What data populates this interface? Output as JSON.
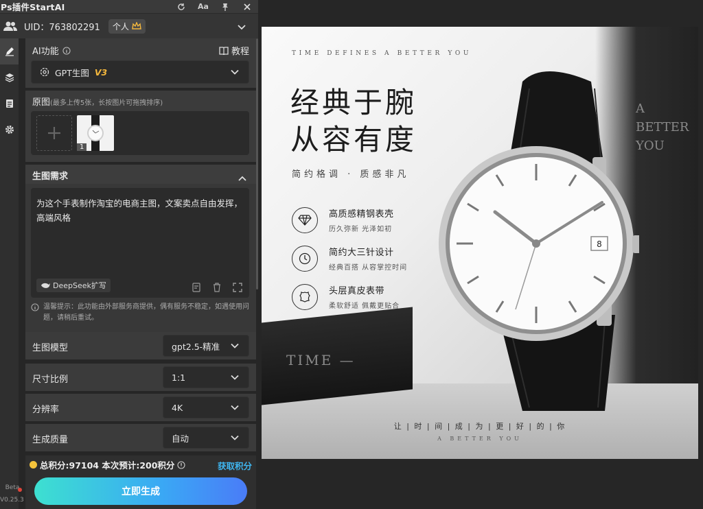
{
  "window": {
    "title": "Ps插件StartAI"
  },
  "titlebar_icons": [
    "refresh-icon",
    "font-size-icon",
    "pin-icon",
    "close-icon"
  ],
  "user": {
    "uid": "UID：763802291",
    "plan": "个人"
  },
  "sidebar": {
    "items": [
      "edit-icon",
      "layers-icon",
      "document-icon",
      "gear-icon"
    ],
    "beta": "Beta",
    "version": "V0.25.3"
  },
  "ai": {
    "label": "AI功能",
    "tutorial": "教程",
    "model_name": "GPT生图",
    "model_version": "V3"
  },
  "original": {
    "label": "原图",
    "hint": "(最多上传5张，长按图片可拖拽排序)",
    "thumb_index": "1"
  },
  "requirement": {
    "label": "生图需求",
    "prompt": "为这个手表制作淘宝的电商主图，文案卖点自由发挥，高端风格",
    "deepseek": "DeepSeek扩写",
    "notice": "温馨提示：此功能由外部服务商提供，偶有服务不稳定，如遇使用问题，请稍后重试。"
  },
  "settings": {
    "model": {
      "label": "生图模型",
      "value": "gpt2.5-精准"
    },
    "ratio": {
      "label": "尺寸比例",
      "value": "1:1"
    },
    "resolution": {
      "label": "分辨率",
      "value": "4K"
    },
    "quality": {
      "label": "生成质量",
      "value": "自动"
    }
  },
  "footer": {
    "credits": "总积分:97104  本次预计:200积分",
    "get_credits": "获取积分",
    "generate": "立即生成"
  },
  "canvas": {
    "tagline": "TIME DEFINES A BETTER YOU",
    "headline1": "经典于腕",
    "headline2": "从容有度",
    "subtitle": "简约格调 · 质感非凡",
    "features": [
      {
        "title": "高质感精钢表壳",
        "desc": "历久弥新  光泽如初",
        "icon": "diamond-icon"
      },
      {
        "title": "简约大三针设计",
        "desc": "经典百搭  从容掌控时间",
        "icon": "clock-icon"
      },
      {
        "title": "头层真皮表带",
        "desc": "柔软舒适  佩戴更贴合",
        "icon": "leather-icon"
      }
    ],
    "right_text1": "A",
    "right_text2": "BETTER",
    "right_text3": "YOU",
    "book_text": "TIME —",
    "bottom_line": "让 | 时 | 间 | 成 | 为 | 更 | 好 | 的 | 你",
    "bottom_en": "A BETTER YOU",
    "date": "8"
  },
  "colors": {
    "accent": "#3aa8f5",
    "gold": "#f5b83d",
    "panel": "#3b3b3b"
  }
}
